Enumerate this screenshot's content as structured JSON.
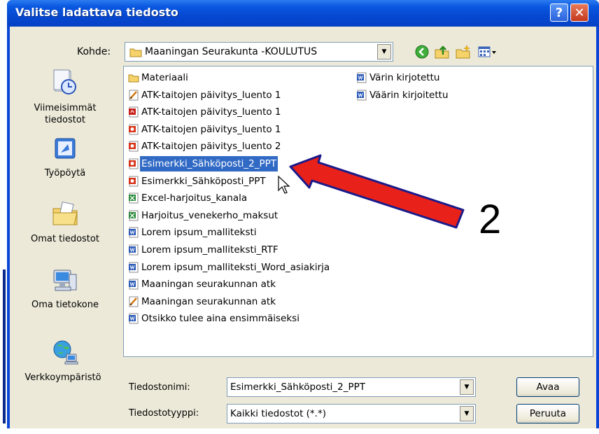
{
  "window": {
    "title": "Valitse ladattava tiedosto"
  },
  "titlebar": {
    "help_glyph": "?",
    "close_glyph": "✕"
  },
  "location": {
    "label": "Kohde:",
    "value": "Maaningan Seurakunta -KOULUTUS"
  },
  "places": [
    {
      "label": "Viimeisimmät tiedostot",
      "icon": "recent-documents-icon"
    },
    {
      "label": "Työpöytä",
      "icon": "desktop-icon"
    },
    {
      "label": "Omat tiedostot",
      "icon": "my-documents-icon"
    },
    {
      "label": "Oma tietokone",
      "icon": "my-computer-icon"
    },
    {
      "label": "Verkkoympäristö",
      "icon": "network-icon"
    }
  ],
  "files_col1": [
    {
      "name": "Materiaali",
      "type": "folder"
    },
    {
      "name": "ATK-taitojen päivitys_luento 1",
      "type": "shortcut"
    },
    {
      "name": "ATK-taitojen päivitys_luento 1",
      "type": "pdf"
    },
    {
      "name": "ATK-taitojen päivitys_luento 1",
      "type": "ppt"
    },
    {
      "name": "ATK-taitojen päivitys_luento 2",
      "type": "ppt"
    },
    {
      "name": "Esimerkki_Sähköposti_2_PPT",
      "type": "ppt",
      "selected": true
    },
    {
      "name": "Esimerkki_Sähköposti_PPT",
      "type": "ppt"
    },
    {
      "name": "Excel-harjoitus_kanala",
      "type": "excel"
    },
    {
      "name": "Harjoitus_venekerho_maksut",
      "type": "excel"
    },
    {
      "name": "Lorem ipsum_malliteksti",
      "type": "word"
    },
    {
      "name": "Lorem ipsum_malliteksti_RTF",
      "type": "word"
    },
    {
      "name": "Lorem ipsum_malliteksti_Word_asiakirja",
      "type": "word"
    },
    {
      "name": "Maaningan seurakunnan atk",
      "type": "word"
    },
    {
      "name": "Maaningan seurakunnan atk",
      "type": "shortcut"
    },
    {
      "name": "Otsikko tulee aina ensimmäiseksi",
      "type": "word"
    }
  ],
  "files_col2": [
    {
      "name": "Värin kirjotettu",
      "type": "word"
    },
    {
      "name": "Väärin kirjoitettu",
      "type": "word"
    }
  ],
  "filename": {
    "label": "Tiedostonimi:",
    "value": "Esimerkki_Sähköposti_2_PPT"
  },
  "filetype": {
    "label": "Tiedostotyyppi:",
    "value": "Kaikki tiedostot (*.*)"
  },
  "buttons": {
    "open": "Avaa",
    "cancel": "Peruuta"
  },
  "annotation": {
    "number": "2"
  },
  "colors": {
    "titlebar": "#0a58e0",
    "selection": "#316ac5",
    "arrow": "#e8221a"
  }
}
